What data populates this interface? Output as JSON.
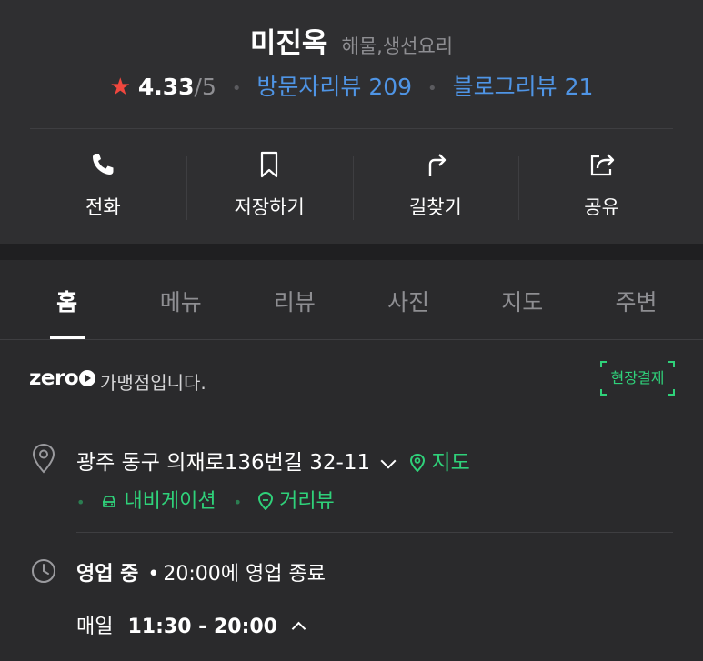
{
  "place": {
    "name": "미진옥",
    "category": "해물,생선요리",
    "rating": "4.33",
    "rating_max": "/5",
    "visitor_reviews": "방문자리뷰 209",
    "blog_reviews": "블로그리뷰 21"
  },
  "actions": [
    {
      "label": "전화",
      "icon": "phone-icon"
    },
    {
      "label": "저장하기",
      "icon": "bookmark-icon"
    },
    {
      "label": "길찾기",
      "icon": "directions-icon"
    },
    {
      "label": "공유",
      "icon": "share-icon"
    }
  ],
  "tabs": [
    {
      "label": "홈",
      "active": true
    },
    {
      "label": "메뉴"
    },
    {
      "label": "리뷰"
    },
    {
      "label": "사진"
    },
    {
      "label": "지도"
    },
    {
      "label": "주변"
    }
  ],
  "zeropay": {
    "logo": "zero",
    "text": "가맹점입니다.",
    "badge": "현장결제"
  },
  "address": {
    "text": "광주 동구 의재로136번길 32-11",
    "map_link": "지도",
    "navigation_link": "내비게이션",
    "streetview_link": "거리뷰"
  },
  "hours": {
    "status": "영업 중",
    "closing": "20:00에 영업 종료",
    "days": "매일",
    "time": "11:30 - 20:00"
  },
  "colors": {
    "accent_green": "#2fd17a",
    "link_blue": "#4f95e6",
    "star_red": "#f0473e"
  }
}
